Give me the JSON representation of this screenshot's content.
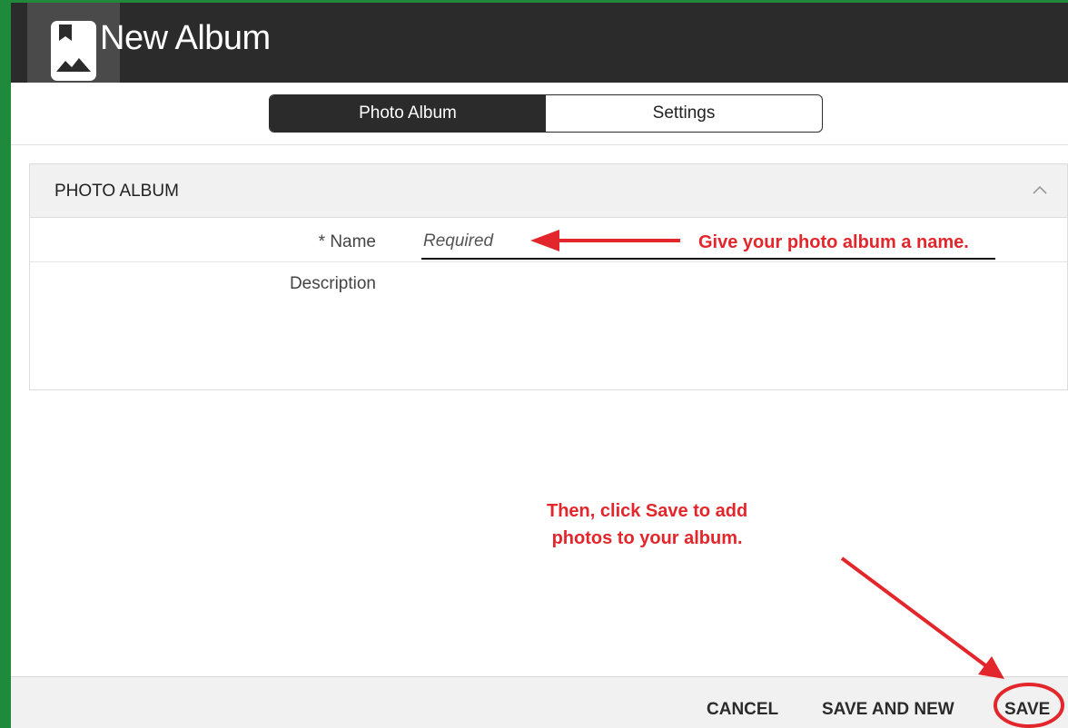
{
  "header": {
    "title": "New Album",
    "icon": "photo-album-icon"
  },
  "tabs": [
    {
      "label": "Photo Album",
      "active": true
    },
    {
      "label": "Settings",
      "active": false
    }
  ],
  "section": {
    "title": "PHOTO ALBUM",
    "collapse_icon": "chevron-up-icon"
  },
  "form": {
    "name_label": "* Name",
    "name_placeholder": "Required",
    "name_value": "",
    "description_label": "Description",
    "description_value": ""
  },
  "annotations": {
    "name_hint": "Give your photo album a name.",
    "save_hint_line1": "Then, click Save to add",
    "save_hint_line2": "photos to your album."
  },
  "footer": {
    "cancel_label": "CANCEL",
    "save_and_new_label": "SAVE AND NEW",
    "save_label": "SAVE"
  },
  "colors": {
    "header_bg": "#2b2b2b",
    "annotation_red": "#e3262b",
    "outer_border": "#1f8a3b"
  }
}
